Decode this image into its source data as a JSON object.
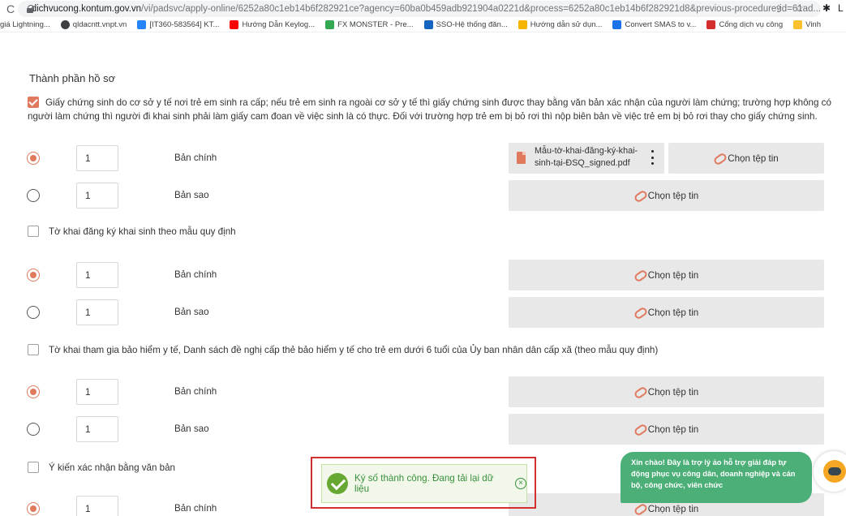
{
  "browser": {
    "url_host": "dichvucong.kontum.gov.vn",
    "url_path": "/vi/padsvc/apply-online/6252a80c1eb14b6f282921ce?agency=60ba0b459adb921904a0221d&process=6252a80c1eb14b6f282921d8&previous-procedure-id=61ad...",
    "profile_initial": "L"
  },
  "bookmarks": [
    {
      "label": "giá Lightning...",
      "icon": "none",
      "color": ""
    },
    {
      "label": "qldacntt.vnpt.vn",
      "icon": "globe-icon",
      "color": "#3c4043"
    },
    {
      "label": "[IT360-583564] KT...",
      "icon": "jira-icon",
      "color": "#2684ff"
    },
    {
      "label": "Hướng Dẫn Keylog...",
      "icon": "youtube-icon",
      "color": "#ff0000"
    },
    {
      "label": "FX MONSTER - Pre...",
      "icon": "drive-icon",
      "color": "#34a853"
    },
    {
      "label": "SSO-Hệ thống đăn...",
      "icon": "sso-icon",
      "color": "#1565c0"
    },
    {
      "label": "Hướng dẫn sử dụn...",
      "icon": "site-icon",
      "color": "#f4b400"
    },
    {
      "label": "Convert SMAS to v...",
      "icon": "sheets-icon",
      "color": "#1a73e8"
    },
    {
      "label": "Cổng dịch vụ công",
      "icon": "emblem-icon",
      "color": "#d32f2f"
    },
    {
      "label": "Vinh",
      "icon": "folder-icon",
      "color": "#fbc02d"
    }
  ],
  "form": {
    "section_title": "Thành phần hồ sơ",
    "description": "Giấy chứng sinh do cơ sở y tế nơi trẻ em sinh ra cấp; nếu trẻ em sinh ra ngoài cơ sở y tế thì giấy chứng sinh được thay bằng văn bản xác nhận của người làm chứng; trường hợp không có người làm chứng thì người đi khai sinh phải làm giấy cam đoan về việc sinh là có thực. Đối với trường hợp trẻ em bị bỏ rơi thì nộp biên bản về việc trẻ em bị bỏ rơi thay cho giấy chứng sinh.",
    "choose_file_label": "Chọn tệp tin",
    "groups": [
      {
        "title": "Tờ khai đăng ký khai sinh theo mẫu quy định"
      },
      {
        "title": "Tờ khai tham gia bảo hiểm y tế, Danh sách đề nghị cấp thẻ bảo hiểm y tế cho trẻ em dưới 6 tuổi của Ủy ban nhân dân cấp xã (theo mẫu quy định)"
      },
      {
        "title": "Ý kiến xác nhận bằng văn bản"
      }
    ],
    "rows": [
      {
        "quantity": "1",
        "type": "Bản chính"
      },
      {
        "quantity": "1",
        "type": "Bản sao"
      },
      {
        "quantity": "1",
        "type": "Bản chính"
      },
      {
        "quantity": "1",
        "type": "Bản sao"
      },
      {
        "quantity": "1",
        "type": "Bản chính"
      },
      {
        "quantity": "1",
        "type": "Bản sao"
      },
      {
        "quantity": "1",
        "type": "Bản chính"
      }
    ],
    "uploaded_file_line1": "Mẫu-tờ-khai-đăng-ký-khai-",
    "uploaded_file_line2": "sinh-tại-ĐSQ_signed.pdf"
  },
  "toast": {
    "message": "Ký số thành công. Đang tải lại dữ liệu"
  },
  "chat": {
    "message": "Xin chào! Đây là trợ lý ảo hỗ trợ giải đáp tự động phục vụ công dân, doanh nghiệp và cán bộ, công chức, viên chức"
  },
  "colors": {
    "accent": "#e07a5f",
    "success": "#66a832",
    "chat_bg": "#4caf78",
    "highlight": "#d32f2f"
  }
}
